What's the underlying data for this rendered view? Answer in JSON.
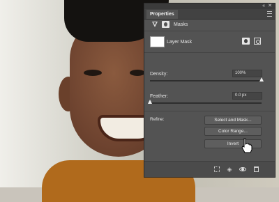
{
  "panel": {
    "tab_label": "Properties",
    "window_controls": {
      "collapse": "«",
      "close": "✕"
    },
    "masks_label": "Masks",
    "layer_mask_label": "Layer Mask",
    "density": {
      "label": "Density:",
      "value": "100%",
      "level_fraction": 1.0
    },
    "feather": {
      "label": "Feather:",
      "value": "0.0 px",
      "level_fraction": 0.0
    },
    "refine_label": "Refine:",
    "buttons": {
      "select_and_mask": "Select and Mask...",
      "color_range": "Color Range...",
      "invert": "Invert"
    },
    "bottom_icons": [
      "load-selection-icon",
      "apply-mask-icon",
      "visibility-eye-icon",
      "trash-icon"
    ],
    "colors": {
      "panel_bg": "#535353",
      "chrome": "#3b3b3b",
      "button_bg": "#5e5e5e"
    }
  }
}
